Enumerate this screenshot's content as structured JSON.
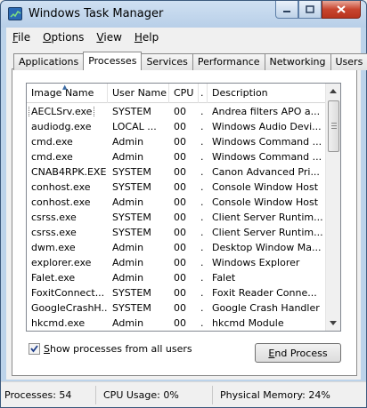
{
  "window": {
    "title": "Windows Task Manager",
    "close_color": "#c8452f"
  },
  "menu": [
    {
      "label": "File",
      "accel": "F",
      "rest": "ile"
    },
    {
      "label": "Options",
      "accel": "O",
      "rest": "ptions"
    },
    {
      "label": "View",
      "accel": "V",
      "rest": "iew"
    },
    {
      "label": "Help",
      "accel": "H",
      "rest": "elp"
    }
  ],
  "tabs": [
    "Applications",
    "Processes",
    "Services",
    "Performance",
    "Networking",
    "Users"
  ],
  "active_tab": "Processes",
  "columns": {
    "image": "Image Name",
    "user": "User Name",
    "cpu": "CPU",
    "dot": ".",
    "desc": "Description"
  },
  "sort_indicator": "▲",
  "processes": [
    {
      "image": "AECLSrv.exe",
      "user": "SYSTEM",
      "cpu": "00",
      "dot": ".",
      "desc": "Andrea filters APO a...",
      "selected": true
    },
    {
      "image": "audiodg.exe",
      "user": "LOCAL ...",
      "cpu": "00",
      "dot": ".",
      "desc": "Windows Audio Devi..."
    },
    {
      "image": "cmd.exe",
      "user": "Admin",
      "cpu": "00",
      "dot": ".",
      "desc": "Windows Command ..."
    },
    {
      "image": "cmd.exe",
      "user": "Admin",
      "cpu": "00",
      "dot": ".",
      "desc": "Windows Command ..."
    },
    {
      "image": "CNAB4RPK.EXE",
      "user": "SYSTEM",
      "cpu": "00",
      "dot": ".",
      "desc": "Canon Advanced Pri..."
    },
    {
      "image": "conhost.exe",
      "user": "SYSTEM",
      "cpu": "00",
      "dot": ".",
      "desc": "Console Window Host"
    },
    {
      "image": "conhost.exe",
      "user": "Admin",
      "cpu": "00",
      "dot": ".",
      "desc": "Console Window Host"
    },
    {
      "image": "csrss.exe",
      "user": "SYSTEM",
      "cpu": "00",
      "dot": ".",
      "desc": "Client Server Runtim..."
    },
    {
      "image": "csrss.exe",
      "user": "SYSTEM",
      "cpu": "00",
      "dot": ".",
      "desc": "Client Server Runtim..."
    },
    {
      "image": "dwm.exe",
      "user": "Admin",
      "cpu": "00",
      "dot": ".",
      "desc": "Desktop Window Ma..."
    },
    {
      "image": "explorer.exe",
      "user": "Admin",
      "cpu": "00",
      "dot": ".",
      "desc": "Windows Explorer"
    },
    {
      "image": "Falet.exe",
      "user": "Admin",
      "cpu": "00",
      "dot": ".",
      "desc": "Falet"
    },
    {
      "image": "FoxitConnect...",
      "user": "SYSTEM",
      "cpu": "00",
      "dot": ".",
      "desc": "Foxit Reader Conne..."
    },
    {
      "image": "GoogleCrashH...",
      "user": "SYSTEM",
      "cpu": "00",
      "dot": ".",
      "desc": "Google Crash Handler"
    },
    {
      "image": "hkcmd.exe",
      "user": "Admin",
      "cpu": "00",
      "dot": ".",
      "desc": "hkcmd Module"
    }
  ],
  "show_all": {
    "label": "Show processes from all users",
    "accel": "S",
    "rest": "how processes from all users",
    "checked": true
  },
  "end_button": {
    "label": "End Process",
    "accel": "E",
    "rest": "nd Process"
  },
  "status": {
    "processes": "Processes: 54",
    "cpu": "CPU Usage: 0%",
    "memory": "Physical Memory: 24%"
  }
}
